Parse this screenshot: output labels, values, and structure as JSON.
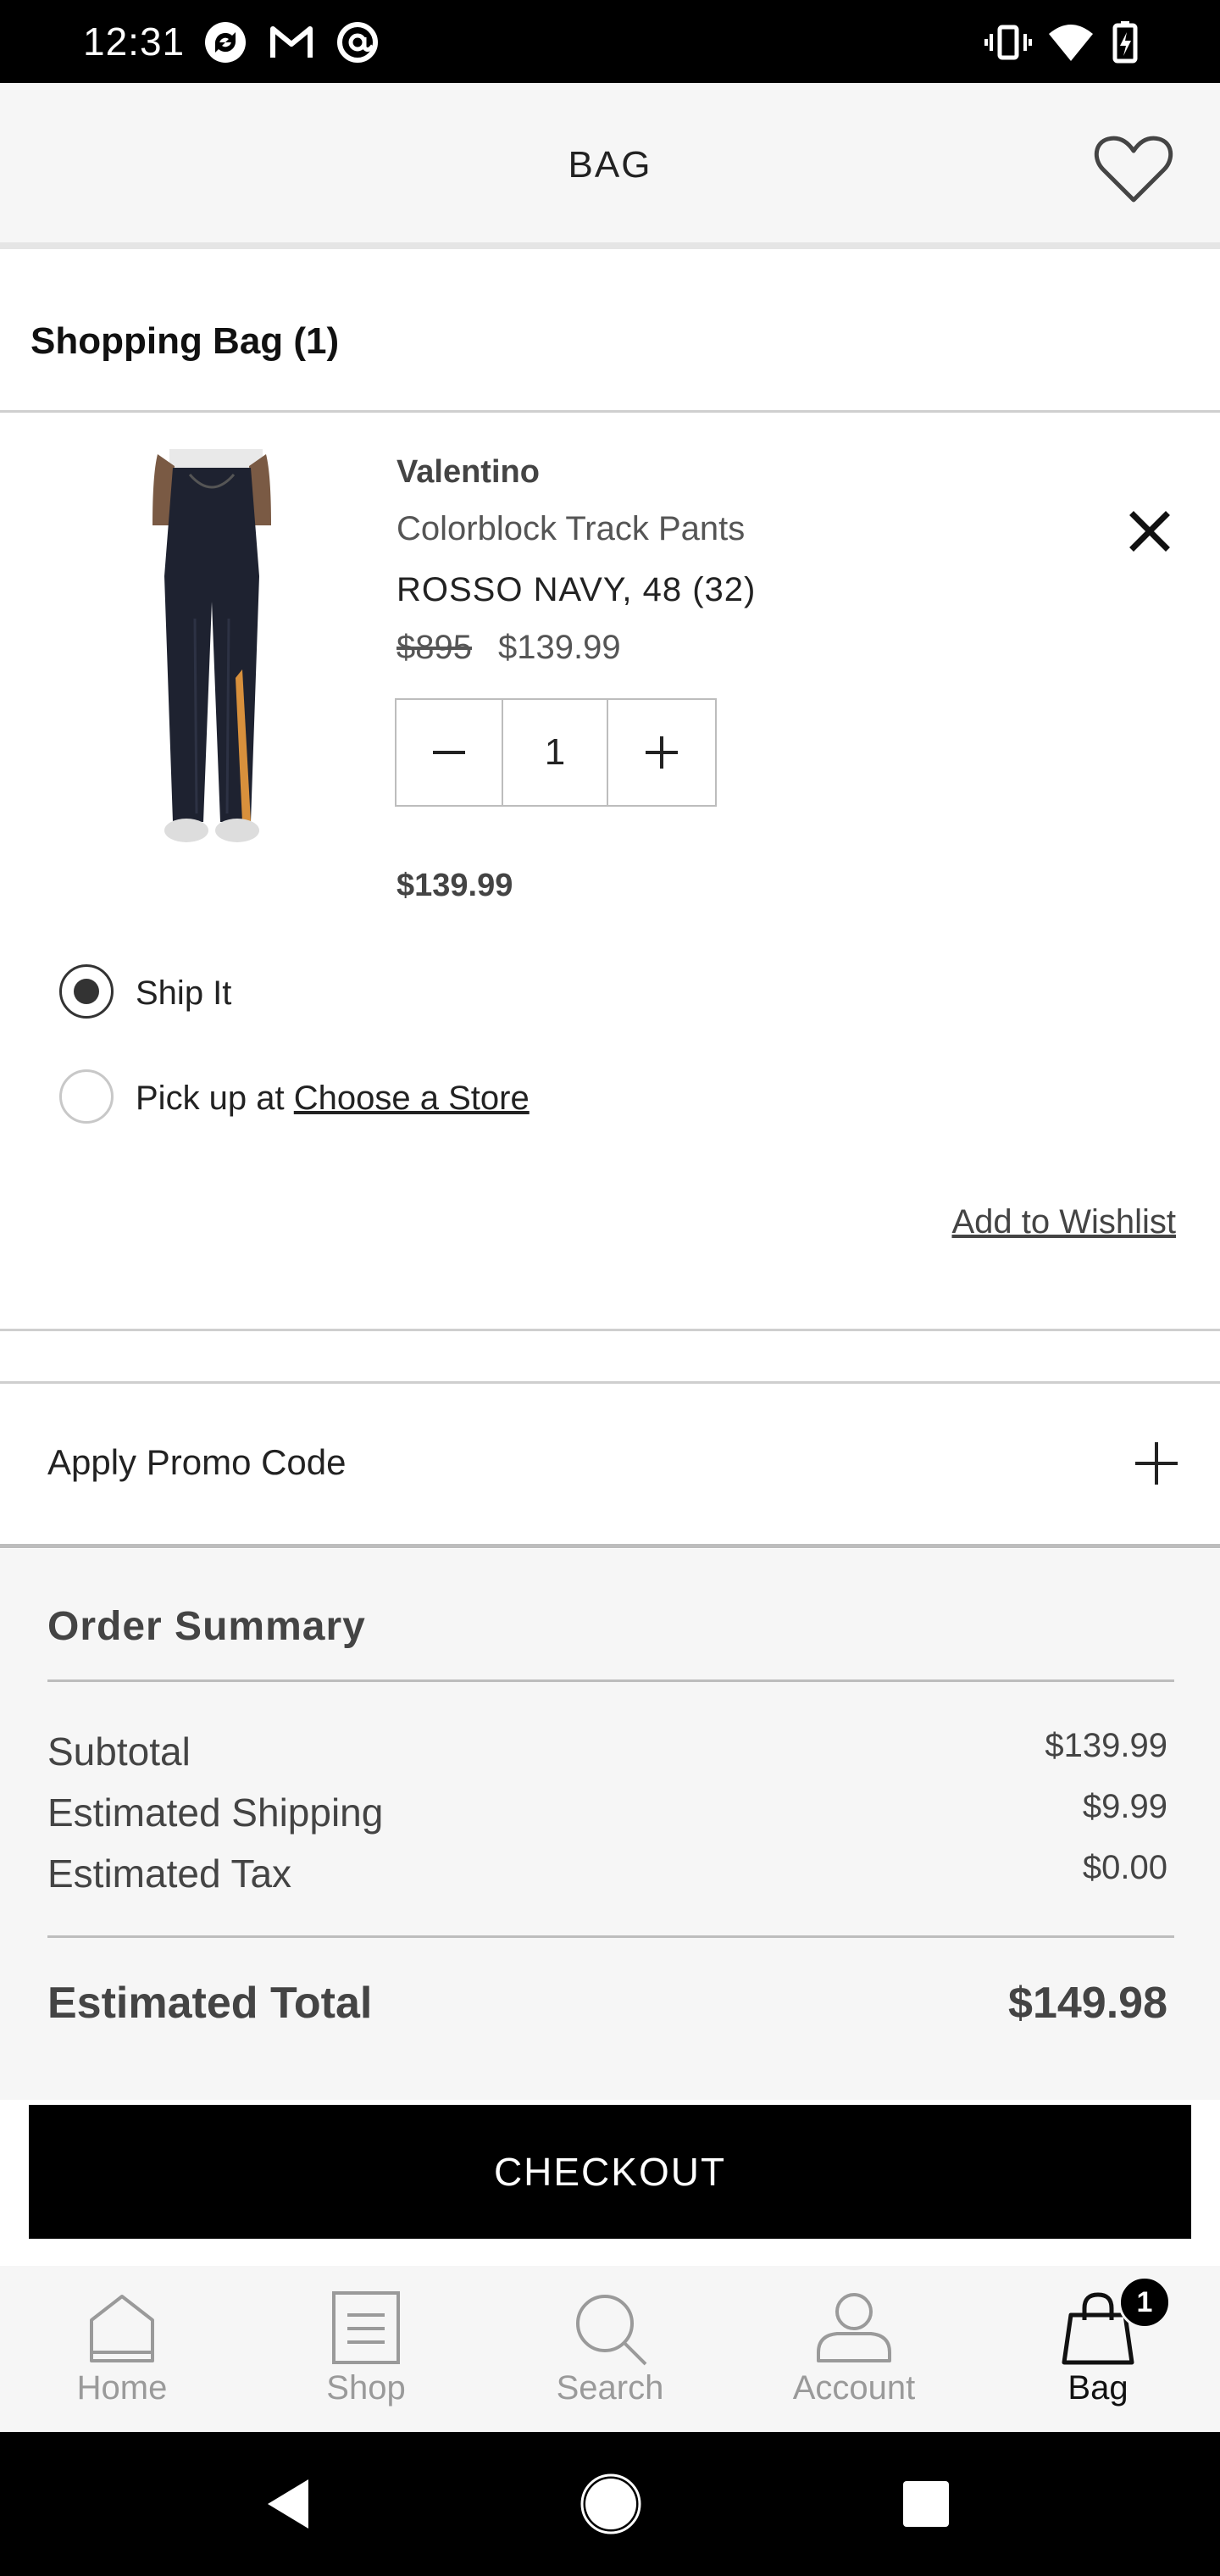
{
  "status_bar": {
    "time": "12:31",
    "left_icons": [
      "sync-icon",
      "gmail-icon",
      "at-icon"
    ],
    "right_icons": [
      "vibrate-icon",
      "wifi-icon",
      "battery-charging-icon"
    ]
  },
  "header": {
    "title": "BAG",
    "wishlist_icon": "heart-outline-icon"
  },
  "bag": {
    "heading": "Shopping Bag (1)",
    "item": {
      "brand": "Valentino",
      "name": "Colorblock Track Pants",
      "variant": "ROSSO NAVY, 48 (32)",
      "original_price": "$895",
      "sale_price": "$139.99",
      "quantity": "1",
      "line_total": "$139.99",
      "remove_icon": "close-icon"
    },
    "fulfillment": {
      "ship_label": "Ship It",
      "pickup_prefix": "Pick up at",
      "pickup_link": "Choose a Store",
      "selected": "ship"
    },
    "wishlist_link": "Add to Wishlist"
  },
  "promo": {
    "label": "Apply Promo Code"
  },
  "summary": {
    "title": "Order Summary",
    "rows": [
      {
        "label": "Subtotal",
        "value": "$139.99"
      },
      {
        "label": "Estimated Shipping",
        "value": "$9.99"
      },
      {
        "label": "Estimated Tax",
        "value": "$0.00"
      }
    ],
    "total_label": "Estimated Total",
    "total_value": "$149.98"
  },
  "checkout": {
    "label": "CHECKOUT"
  },
  "bottom_nav": {
    "items": [
      {
        "label": "Home",
        "icon": "home-icon"
      },
      {
        "label": "Shop",
        "icon": "shop-icon"
      },
      {
        "label": "Search",
        "icon": "search-icon"
      },
      {
        "label": "Account",
        "icon": "account-icon"
      },
      {
        "label": "Bag",
        "icon": "bag-icon",
        "badge": "1"
      }
    ],
    "active": "Bag"
  },
  "colors": {
    "accent": "#000000",
    "header_bg": "#f6f6f6",
    "summary_bg": "#f6f6f6"
  }
}
